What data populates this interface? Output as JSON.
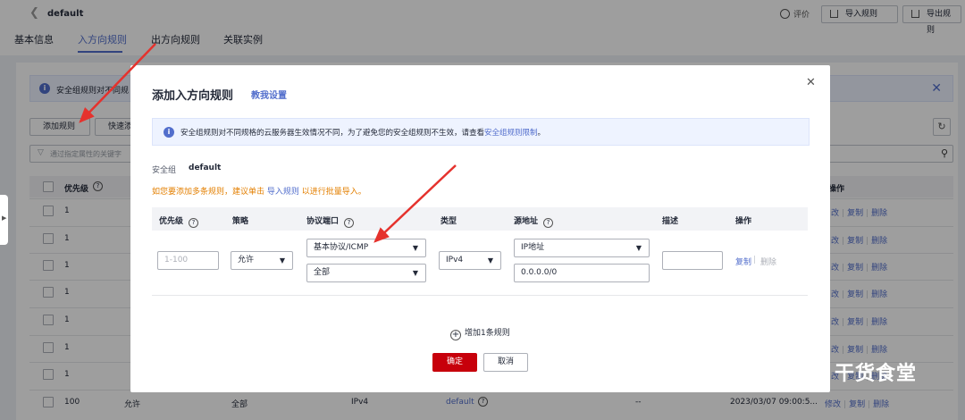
{
  "header": {
    "back_icon": "chevron-left-icon",
    "title": "default",
    "rate": "评价",
    "import_label": "导入规则",
    "export_label": "导出规则"
  },
  "tabs": [
    {
      "label": "基本信息"
    },
    {
      "label": "入方向规则",
      "active": true
    },
    {
      "label": "出方向规则"
    },
    {
      "label": "关联实例"
    }
  ],
  "bg_info": "安全组规则对不同规",
  "bg_buttons": {
    "add": "添加规则",
    "quick": "快速添"
  },
  "filter_placeholder": "通过指定属性的关键字",
  "bg_table": {
    "col_priority": "优先级",
    "col_ops": "操作",
    "rows": [
      {
        "priority": "1",
        "ops": [
          "改",
          "复制",
          "删除"
        ]
      },
      {
        "priority": "1",
        "ops": [
          "改",
          "复制",
          "删除"
        ]
      },
      {
        "priority": "1",
        "ops": [
          "改",
          "复制",
          "删除"
        ]
      },
      {
        "priority": "1",
        "ops": [
          "改",
          "复制",
          "删除"
        ]
      },
      {
        "priority": "1",
        "ops": [
          "改",
          "复制",
          "删除"
        ]
      },
      {
        "priority": "1",
        "ops": [
          "改",
          "复制",
          "删除"
        ]
      },
      {
        "priority": "1",
        "ops": [
          "改",
          "复制",
          "删除"
        ]
      },
      {
        "priority": "100",
        "policy": "允许",
        "protocol": "全部",
        "type": "IPv4",
        "source": "default",
        "desc": "--",
        "time": "2023/03/07 09:00:5...",
        "ops": [
          "修改",
          "复制",
          "删除"
        ]
      }
    ]
  },
  "modal": {
    "title": "添加入方向规则",
    "help": "教我设置",
    "info_text": "安全组规则对不同规格的云服务器生效情况不同，为了避免您的安全组规则不生效，请查看",
    "info_link": "安全组规则限制",
    "info_tail": "。",
    "sg_label": "安全组",
    "sg_value": "default",
    "hint_pre": "如您要添加多条规则，建议单击 ",
    "hint_link": "导入规则",
    "hint_post": " 以进行批量导入。",
    "columns": {
      "priority": "优先级",
      "policy": "策略",
      "protocol": "协议端口",
      "type": "类型",
      "source": "源地址",
      "desc": "描述",
      "ops": "操作"
    },
    "row": {
      "priority_placeholder": "1-100",
      "policy": "允许",
      "protocol": "基本协议/ICMP",
      "port": "全部",
      "type": "IPv4",
      "source_type": "IP地址",
      "source_value": "0.0.0.0/0",
      "desc": "",
      "copy": "复制",
      "delete": "删除"
    },
    "add_rule": "增加1条规则",
    "ok": "确定",
    "cancel": "取消"
  },
  "watermark": "干货食堂",
  "colors": {
    "accent": "#526ecc",
    "primary_button": "#c7000b",
    "hint": "#e37f00",
    "arrow": "#e5322d"
  }
}
